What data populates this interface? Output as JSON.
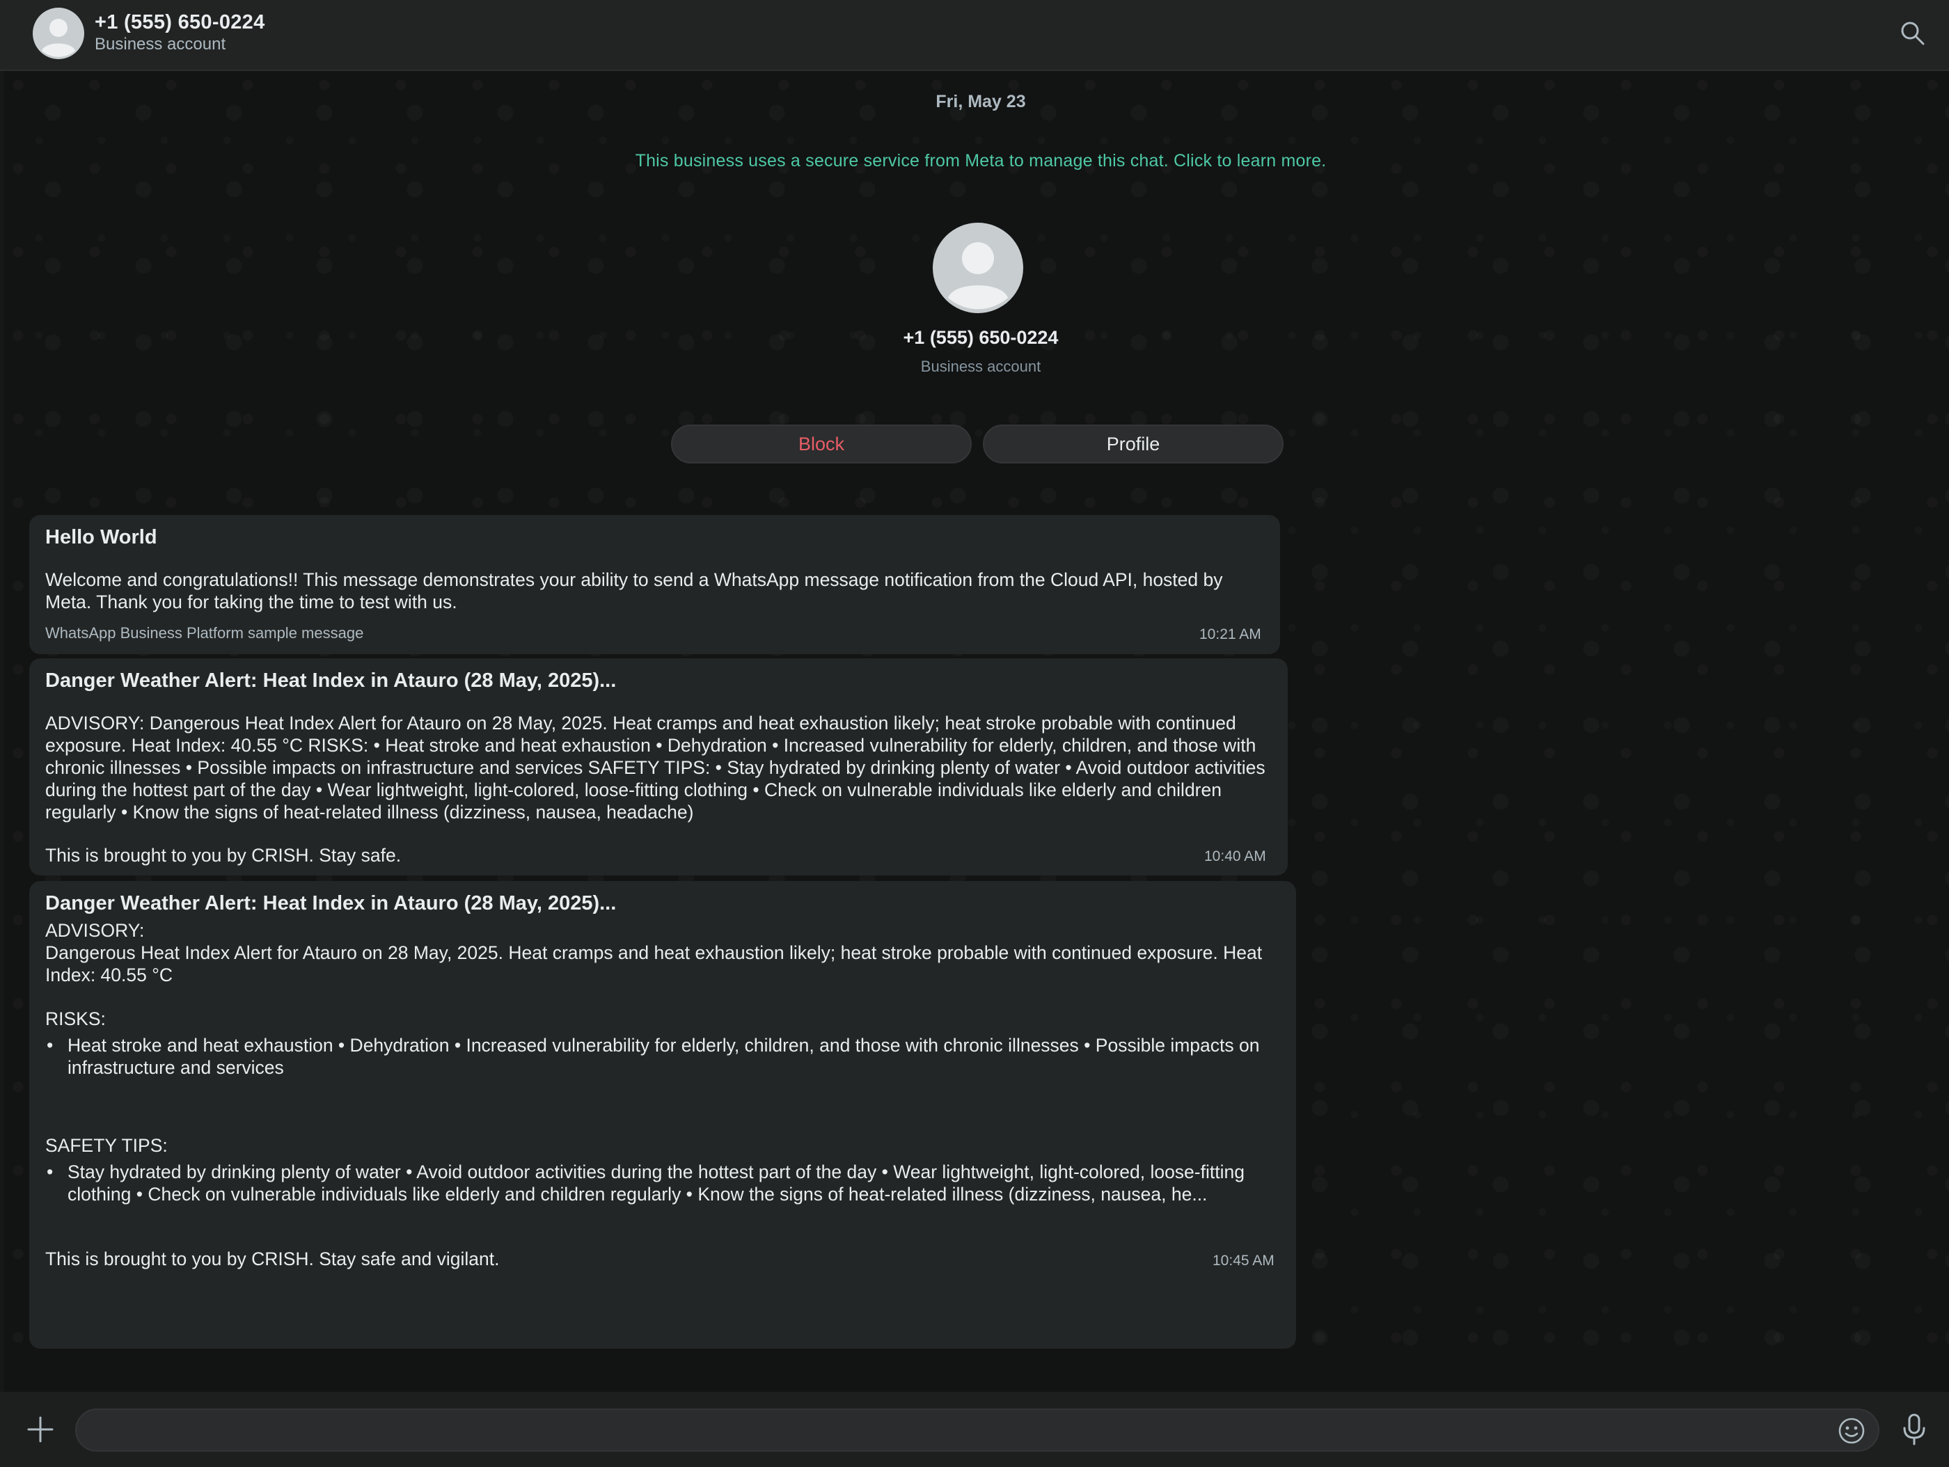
{
  "header": {
    "title": "+1 (555) 650-0224",
    "subtitle": "Business account",
    "icons": {
      "avatar": "default-avatar",
      "search": "search-icon"
    }
  },
  "chat": {
    "date_label": "Fri, May 23",
    "meta_notice": "This business uses a secure service from Meta to manage this chat. Click to learn more.",
    "profile": {
      "name": "+1 (555) 650-0224",
      "subtitle": "Business account",
      "block_label": "Block",
      "profile_label": "Profile"
    },
    "messages": [
      {
        "title": "Hello World",
        "body": "Welcome and congratulations!! This message demonstrates your ability to send a WhatsApp message notification from the Cloud API, hosted by Meta. Thank you for taking the time to test with us.",
        "footer": "WhatsApp Business Platform sample message",
        "time": "10:21 AM"
      },
      {
        "title": "Danger Weather Alert: Heat Index in Atauro (28 May, 2025)...",
        "body": "ADVISORY: Dangerous Heat Index Alert for Atauro on 28 May, 2025. Heat cramps and heat exhaustion likely; heat stroke probable with continued exposure. Heat Index: 40.55 °C RISKS: • Heat stroke and heat exhaustion • Dehydration • Increased vulnerability for elderly, children, and those with chronic illnesses • Possible impacts on infrastructure and services SAFETY TIPS: • Stay hydrated by drinking plenty of water • Avoid outdoor activities during the hottest part of the day • Wear lightweight, light-colored, loose-fitting clothing • Check on vulnerable individuals like elderly and children regularly • Know the signs of heat-related illness (dizziness, nausea, headache)",
        "closing": "This is brought to you by CRISH. Stay safe.",
        "time": "10:40 AM"
      },
      {
        "title": "Danger Weather Alert: Heat Index in Atauro (28 May, 2025)...",
        "advisory_label": "ADVISORY:",
        "advisory_text": "Dangerous Heat Index Alert for Atauro on 28 May, 2025. Heat cramps and heat exhaustion likely; heat stroke probable with continued exposure. Heat Index: 40.55 °C",
        "risks_label": "RISKS:",
        "risks_item": "Heat stroke and heat exhaustion • Dehydration • Increased vulnerability for elderly, children, and those with chronic illnesses • Possible impacts on infrastructure and services",
        "safety_label": "SAFETY TIPS:",
        "safety_item": "Stay hydrated by drinking plenty of water • Avoid outdoor activities during the hottest part of the day • Wear lightweight, light-colored, loose-fitting clothing • Check on vulnerable individuals like elderly and children regularly • Know the signs of heat-related illness (dizziness, nausea, he...",
        "closing": "This is brought to you by CRISH. Stay safe and vigilant.",
        "time": "10:45 AM"
      }
    ]
  },
  "composer": {
    "value": "",
    "icons": {
      "attach": "plus-icon",
      "emoji": "emoji-icon",
      "voice": "microphone-icon"
    }
  },
  "colors": {
    "background": "#161717",
    "header": "#222424",
    "bubble": "#232626",
    "link": "#4ec9a5",
    "danger": "#e85d67",
    "text": "#e9edef",
    "muted": "#aebac1"
  }
}
